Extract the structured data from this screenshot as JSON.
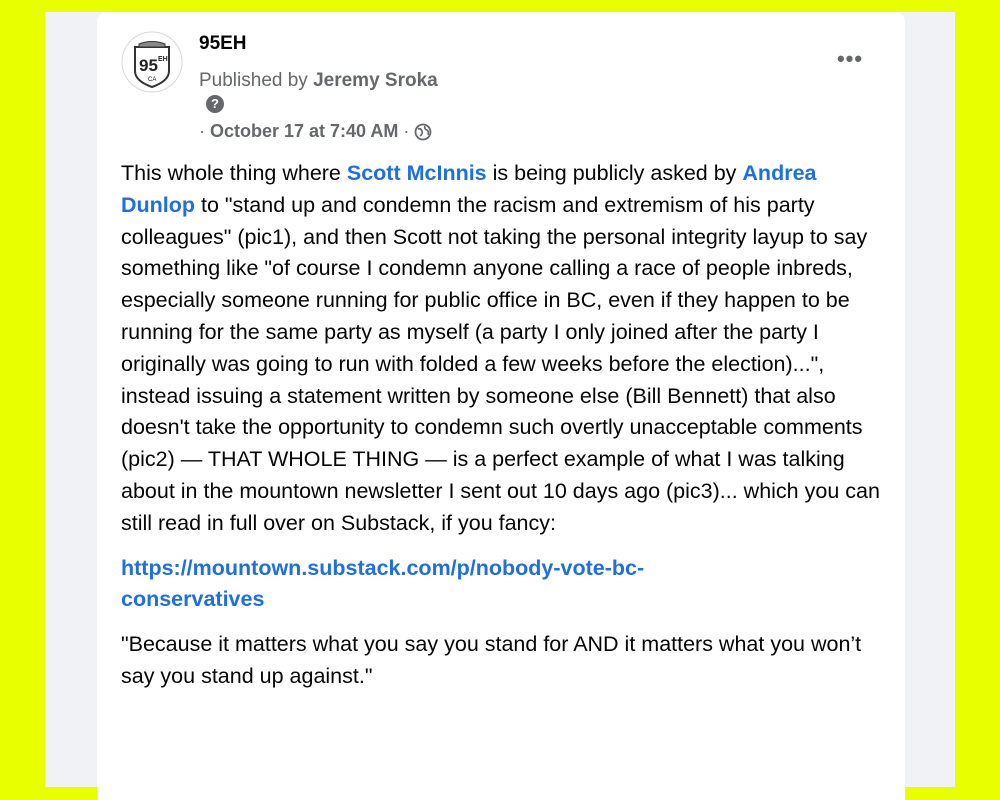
{
  "post": {
    "page_name": "95EH",
    "avatar": {
      "main": "95",
      "sup": "EH",
      "sub": "CA"
    },
    "published_by_prefix": "Published by ",
    "published_by_name": "Jeremy Sroka",
    "help_icon": "question-icon",
    "date_prefix": "·",
    "date": "October 17 at 7:40 AM",
    "date_suffix": "·",
    "audience_icon": "globe-icon",
    "more_label": "•••",
    "body": {
      "p1_part1": "This whole thing where ",
      "mention1": "Scott McInnis",
      "p1_part2": " is being publicly asked by ",
      "mention2": "Andrea Dunlop",
      "p1_part3": " to \"stand up and condemn the racism and extremism of his party colleagues\" (pic1), and then Scott not taking the personal integrity layup to say something like \"of course I condemn anyone calling a race of people inbreds, especially someone running for public office in BC, even if they happen to be running for the same party as myself (a party I only joined after the party I originally was going to run with folded a few weeks before the election)...\", instead issuing a statement written by someone else (Bill Bennett) that also doesn't take the opportunity to condemn such overtly unacceptable comments (pic2) — THAT WHOLE THING — is a perfect example of what I was talking about in the mountown newsletter I sent out 10 days ago (pic3)... which you can still read in full over on Substack, if you fancy:",
      "link_line1": "https://mountown.substack.com/p/nobody-vote-bc-",
      "link_line2": "conservatives",
      "quote": "\"Because it matters what you say you stand for AND it matters what you won’t say you stand up against.\""
    }
  },
  "colors": {
    "page_background": "#e8ff00",
    "feed_background": "#f0f2f5",
    "card_background": "#ffffff",
    "link": "#216fdb",
    "secondary_text": "#65676b"
  }
}
